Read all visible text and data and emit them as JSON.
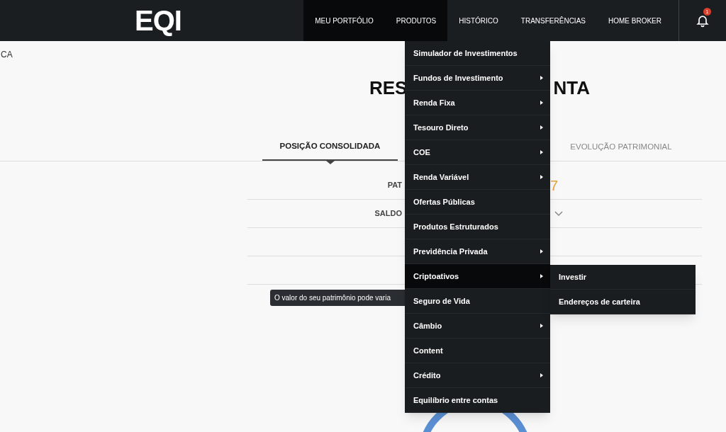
{
  "header": {
    "logo": "EQI",
    "nav": [
      {
        "label": "MEU PORTFÓLIO",
        "highlighted": true
      },
      {
        "label": "PRODUTOS",
        "highlighted": true
      },
      {
        "label": "HISTÓRICO",
        "highlighted": false
      },
      {
        "label": "TRANSFERÊNCIAS",
        "highlighted": false
      },
      {
        "label": "HOME BROKER",
        "highlighted": false
      }
    ],
    "notification_count": "1"
  },
  "breadcrumb": "CA",
  "title_parts": [
    "RES",
    "NTA"
  ],
  "tabs": [
    {
      "label": "POSIÇÃO CONSOLIDADA",
      "selected": true
    },
    {
      "label": "EVOLUÇÃO PATRIMONIAL",
      "selected": false
    }
  ],
  "rows": [
    {
      "label": "PAT",
      "value": "7",
      "expandable": false
    },
    {
      "label": "SALDO",
      "expandable": true
    }
  ],
  "tooltip": "O valor do seu patrimônio pode varia",
  "menu": {
    "items": [
      {
        "label": "Simulador de Investimentos",
        "has_submenu": false,
        "selected": false
      },
      {
        "label": "Fundos de Investimento",
        "has_submenu": true,
        "selected": false
      },
      {
        "label": "Renda Fixa",
        "has_submenu": true,
        "selected": false
      },
      {
        "label": "Tesouro Direto",
        "has_submenu": true,
        "selected": false
      },
      {
        "label": "COE",
        "has_submenu": true,
        "selected": false
      },
      {
        "label": "Renda Variável",
        "has_submenu": true,
        "selected": false
      },
      {
        "label": "Ofertas Públicas",
        "has_submenu": false,
        "selected": false
      },
      {
        "label": "Produtos Estruturados",
        "has_submenu": false,
        "selected": false
      },
      {
        "label": "Previdência Privada",
        "has_submenu": true,
        "selected": false
      },
      {
        "label": "Criptoativos",
        "has_submenu": true,
        "selected": true
      },
      {
        "label": "Seguro de Vida",
        "has_submenu": false,
        "selected": false
      },
      {
        "label": "Câmbio",
        "has_submenu": true,
        "selected": false
      },
      {
        "label": "Content",
        "has_submenu": false,
        "selected": false
      },
      {
        "label": "Crédito",
        "has_submenu": true,
        "selected": false
      },
      {
        "label": "Equilíbrio entre contas",
        "has_submenu": false,
        "selected": false
      }
    ],
    "submenu": [
      "Investir",
      "Endereços de carteira"
    ]
  }
}
